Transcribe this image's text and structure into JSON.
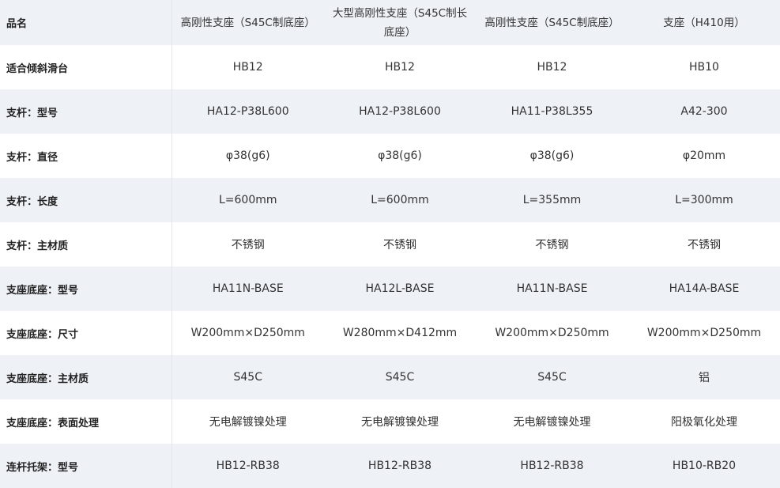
{
  "table": {
    "corner_label": "品名",
    "columns": [
      "高刚性支座（S45C制底座）",
      "大型高刚性支座（S45C制长底座）",
      "高刚性支座（S45C制底座）",
      "支座（H410用）"
    ],
    "rows": [
      {
        "label": "适合倾斜滑台",
        "cells": [
          "HB12",
          "HB12",
          "HB12",
          "HB10"
        ]
      },
      {
        "label": "支杆：型号",
        "cells": [
          "HA12-P38L600",
          "HA12-P38L600",
          "HA11-P38L355",
          "A42-300"
        ]
      },
      {
        "label": "支杆：直径",
        "cells": [
          "φ38(g6)",
          "φ38(g6)",
          "φ38(g6)",
          "φ20mm"
        ]
      },
      {
        "label": "支杆：长度",
        "cells": [
          "L=600mm",
          "L=600mm",
          "L=355mm",
          "L=300mm"
        ]
      },
      {
        "label": "支杆：主材质",
        "cells": [
          "不锈钢",
          "不锈钢",
          "不锈钢",
          "不锈钢"
        ]
      },
      {
        "label": "支座底座：型号",
        "cells": [
          "HA11N-BASE",
          "HA12L-BASE",
          "HA11N-BASE",
          "HA14A-BASE"
        ]
      },
      {
        "label": "支座底座：尺寸",
        "cells": [
          "W200mm×D250mm",
          "W280mm×D412mm",
          "W200mm×D250mm",
          "W200mm×D250mm"
        ]
      },
      {
        "label": "支座底座：主材质",
        "cells": [
          "S45C",
          "S45C",
          "S45C",
          "铝"
        ]
      },
      {
        "label": "支座底座：表面处理",
        "cells": [
          "无电解镀镍处理",
          "无电解镀镍处理",
          "无电解镀镍处理",
          "阳极氧化处理"
        ]
      },
      {
        "label": "连杆托架：型号",
        "cells": [
          "HB12-RB38",
          "HB12-RB38",
          "HB12-RB38",
          "HB10-RB20"
        ]
      }
    ]
  },
  "colors": {
    "stripe": "#eef2f7",
    "text": "#333333",
    "label_text": "#222222"
  }
}
